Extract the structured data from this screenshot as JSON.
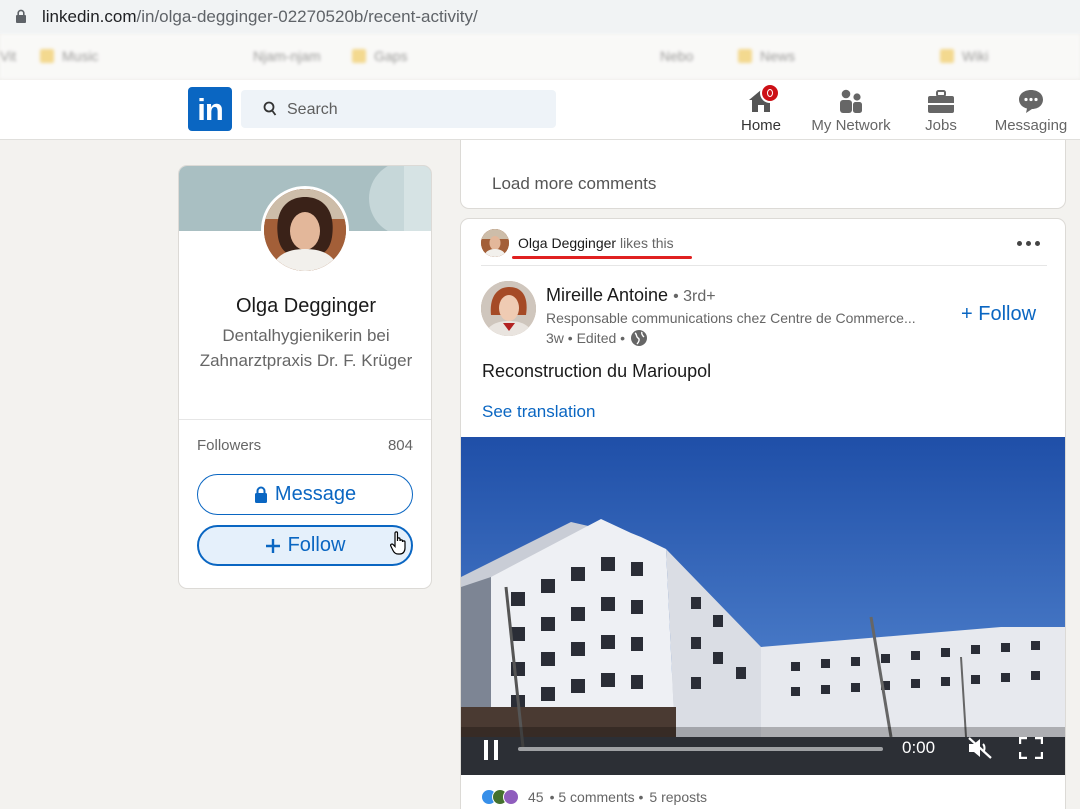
{
  "browser": {
    "url_host": "linkedin.com",
    "url_path": "/in/olga-degginger-02270520b/recent-activity/"
  },
  "bookmarks": [
    "Vit",
    "Music",
    "Njam-njam",
    "Gaps",
    "Nebo",
    "News",
    "Wiki"
  ],
  "nav": {
    "logo": "in",
    "search_placeholder": "Search",
    "items": [
      {
        "label": "Home",
        "icon": "home-icon"
      },
      {
        "label": "My Network",
        "icon": "network-icon"
      },
      {
        "label": "Jobs",
        "icon": "briefcase-icon"
      },
      {
        "label": "Messaging",
        "icon": "messaging-icon"
      }
    ]
  },
  "profile": {
    "name": "Olga Degginger",
    "headline": "Dentalhygienikerin bei Zahnarztpraxis Dr. F. Krüger",
    "followers_label": "Followers",
    "followers_count": "804",
    "message_label": "Message",
    "follow_label": "Follow"
  },
  "comments": {
    "load_more": "Load more comments"
  },
  "post": {
    "liker": "Olga Degginger",
    "liker_action": "likes this",
    "author_name": "Mireille Antoine",
    "author_degree": "• 3rd+",
    "author_headline": "Responsable communications chez Centre de Commerce...",
    "meta": "3w • Edited •",
    "follow_label": "+ Follow",
    "text": "Reconstruction du Marioupol",
    "see_translation": "See translation",
    "video_time": "0:00",
    "video_progress": 0,
    "reactions_count": "45",
    "comments_count": "• 5 comments •",
    "reposts_count": "5 reposts"
  },
  "colors": {
    "linkedin_blue": "#0a66c2",
    "notification_red": "#cc1016",
    "underline_red": "#e02020"
  }
}
